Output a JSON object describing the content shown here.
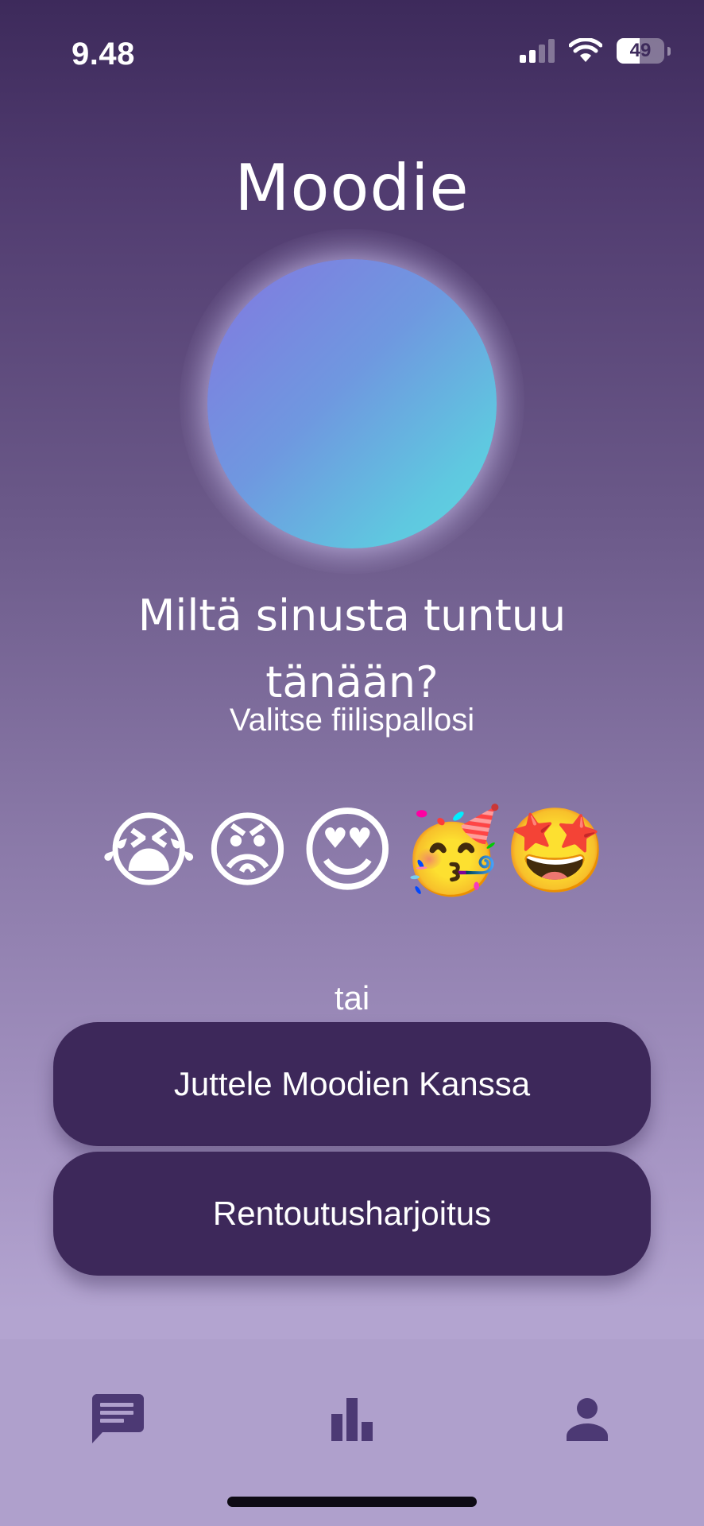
{
  "status_bar": {
    "time": "9.48",
    "battery_level": "49",
    "battery_fraction": 0.49,
    "icons": [
      "cellular-signal-icon",
      "wifi-icon",
      "battery-icon"
    ]
  },
  "header": {
    "title": "Moodie"
  },
  "mood_orb": {
    "colors": [
      "#8377e0",
      "#6f98e0",
      "#5ed8e0"
    ]
  },
  "prompt": {
    "question": "Miltä sinusta tuntuu tänään?",
    "subtitle": "Valitse fiilispallosi"
  },
  "emojis": [
    {
      "glyph": "😭",
      "name": "loudly-crying-face"
    },
    {
      "glyph": "😡",
      "name": "angry-face"
    },
    {
      "glyph": "😍",
      "name": "heart-eyes-face"
    },
    {
      "glyph": "🥳",
      "name": "partying-face"
    },
    {
      "glyph": "🤩",
      "name": "star-struck-face"
    }
  ],
  "divider": "tai",
  "actions": {
    "chat_label": "Juttele Moodien Kanssa",
    "relax_label": "Rentoutusharjoitus"
  },
  "bottom_nav": {
    "items": [
      {
        "icon": "chat-icon",
        "active": true
      },
      {
        "icon": "bar-chart-icon",
        "active": false
      },
      {
        "icon": "person-icon",
        "active": false
      }
    ],
    "icon_color": "#4c3974"
  },
  "colors": {
    "button_bg": "#3d285a",
    "background_top": "#3d2a5b",
    "background_bottom": "#b1a3ce"
  }
}
